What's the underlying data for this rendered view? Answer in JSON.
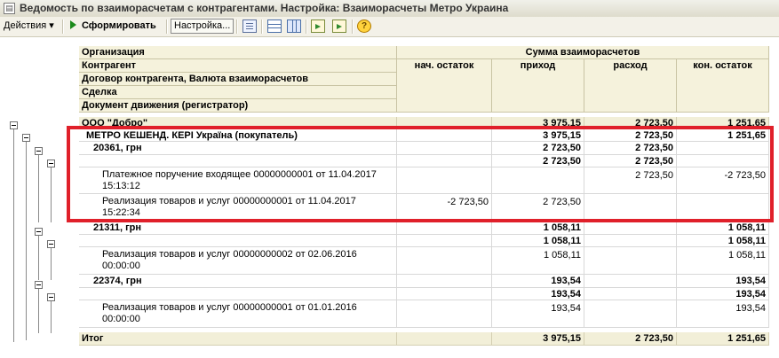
{
  "window": {
    "title": "Ведомость по взаиморасчетам с контрагентами. Настройка: Взаиморасчеты Метро Украина"
  },
  "toolbar": {
    "actions_label": "Действия",
    "run_label": "Сформировать",
    "settings_label": "Настройка...",
    "help_label": "?"
  },
  "header": {
    "dim_labels": [
      "Организация",
      "Контрагент",
      "Договор контрагента, Валюта взаиморасчетов",
      "Сделка",
      "Документ движения (регистратор)"
    ],
    "group_label": "Сумма взаиморасчетов",
    "columns": [
      "нач. остаток",
      "приход",
      "расход",
      "кон. остаток"
    ]
  },
  "rows": {
    "r1": {
      "label": "ООО \"Добро\"",
      "start": "",
      "in": "3 975,15",
      "out": "2 723,50",
      "end": "1 251,65"
    },
    "r2": {
      "label": "МЕТРО КЕШЕНД. КЕРІ Україна (покупатель)",
      "start": "",
      "in": "3 975,15",
      "out": "2 723,50",
      "end": "1 251,65"
    },
    "r3": {
      "label": "20361, грн",
      "start": "",
      "in": "2 723,50",
      "out": "2 723,50",
      "end": ""
    },
    "r4": {
      "label": "",
      "start": "",
      "in": "2 723,50",
      "out": "2 723,50",
      "end": ""
    },
    "r5": {
      "label": "Платежное поручение входящее 00000000001 от 11.04.2017 15:13:12",
      "start": "",
      "in": "",
      "out": "2 723,50",
      "end": "-2 723,50"
    },
    "r6": {
      "label": "Реализация товаров и услуг 00000000001 от 11.04.2017 15:22:34",
      "start": "-2 723,50",
      "in": "2 723,50",
      "out": "",
      "end": ""
    },
    "r7": {
      "label": "21311, грн",
      "start": "",
      "in": "1 058,11",
      "out": "",
      "end": "1 058,11"
    },
    "r8": {
      "label": "",
      "start": "",
      "in": "1 058,11",
      "out": "",
      "end": "1 058,11"
    },
    "r9": {
      "label": "Реализация товаров и услуг 00000000002 от 02.06.2016 00:00:00",
      "start": "",
      "in": "1 058,11",
      "out": "",
      "end": "1 058,11"
    },
    "r10": {
      "label": "22374, грн",
      "start": "",
      "in": "193,54",
      "out": "",
      "end": "193,54"
    },
    "r11": {
      "label": "",
      "start": "",
      "in": "193,54",
      "out": "",
      "end": "193,54"
    },
    "r12": {
      "label": "Реализация товаров и услуг 00000000001 от 01.01.2016 00:00:00",
      "start": "",
      "in": "193,54",
      "out": "",
      "end": "193,54"
    },
    "total": {
      "label": "Итог",
      "start": "",
      "in": "3 975,15",
      "out": "2 723,50",
      "end": "1 251,65"
    }
  },
  "accent": {
    "highlight": "#e0202a",
    "header_bg": "#f5f2dc",
    "run_icon": "#1b8a1b"
  }
}
